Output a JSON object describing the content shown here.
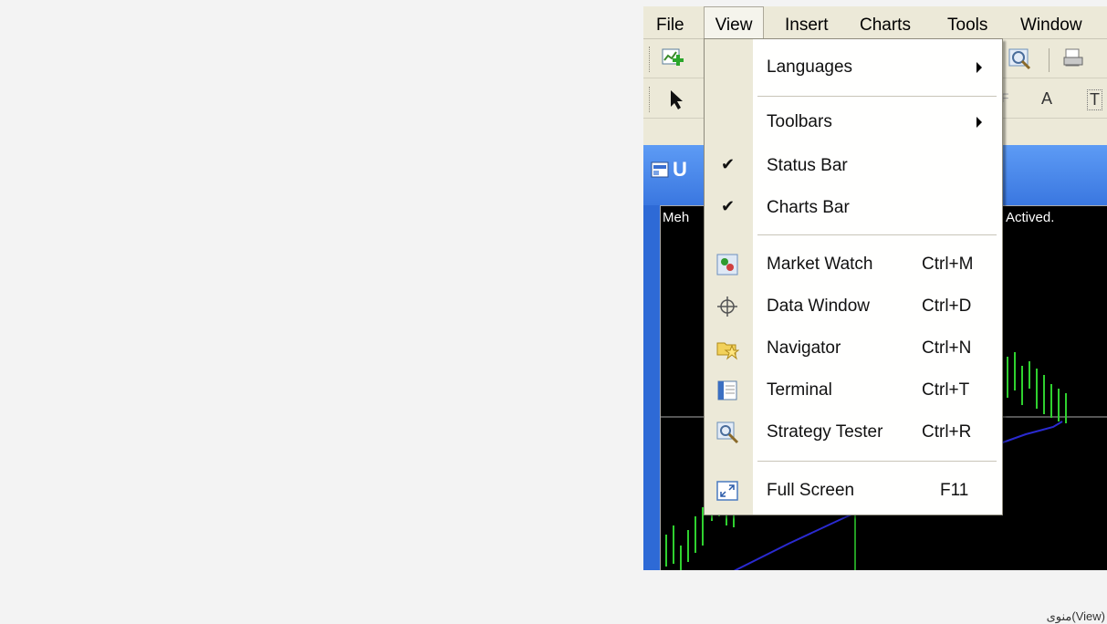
{
  "menubar": {
    "items": [
      "File",
      "View",
      "Insert",
      "Charts",
      "Tools",
      "Window"
    ]
  },
  "toolbar2": {
    "text_tool": "A",
    "label_tool": "T"
  },
  "chart": {
    "title_initial": "U",
    "symbol_prefix": "Meh",
    "status_text": "Actived."
  },
  "view_menu": {
    "languages": "Languages",
    "toolbars": "Toolbars",
    "status_bar": "Status Bar",
    "charts_bar": "Charts Bar",
    "market_watch": {
      "label": "Market Watch",
      "shortcut": "Ctrl+M"
    },
    "data_window": {
      "label": "Data Window",
      "shortcut": "Ctrl+D"
    },
    "navigator": {
      "label": "Navigator",
      "shortcut": "Ctrl+N"
    },
    "terminal": {
      "label": "Terminal",
      "shortcut": "Ctrl+T"
    },
    "strategy_tester": {
      "label": "Strategy Tester",
      "shortcut": "Ctrl+R"
    },
    "full_screen": {
      "label": "Full Screen",
      "shortcut": "F11"
    },
    "check_mark": "✔"
  },
  "caption": "منوی(View)"
}
